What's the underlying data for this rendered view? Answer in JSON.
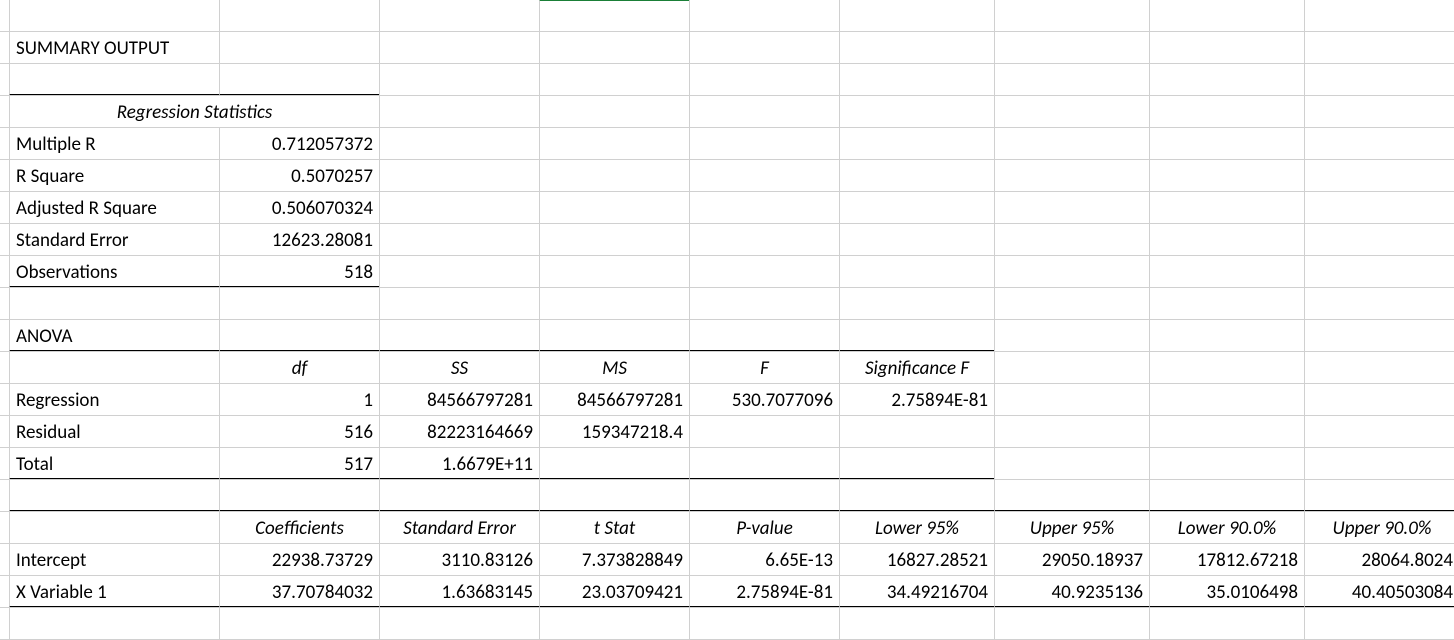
{
  "title": "SUMMARY OUTPUT",
  "regstats": {
    "header": "Regression Statistics",
    "rows": [
      {
        "label": "Multiple R",
        "value": "0.712057372"
      },
      {
        "label": "R Square",
        "value": "0.5070257"
      },
      {
        "label": "Adjusted R Square",
        "value": "0.506070324"
      },
      {
        "label": "Standard Error",
        "value": "12623.28081"
      },
      {
        "label": "Observations",
        "value": "518"
      }
    ]
  },
  "anova": {
    "title": "ANOVA",
    "headers": [
      "df",
      "SS",
      "MS",
      "F",
      "Significance F"
    ],
    "rows": [
      {
        "label": "Regression",
        "df": "1",
        "ss": "84566797281",
        "ms": "84566797281",
        "f": "530.7077096",
        "sigf": "2.75894E-81"
      },
      {
        "label": "Residual",
        "df": "516",
        "ss": "82223164669",
        "ms": "159347218.4",
        "f": "",
        "sigf": ""
      },
      {
        "label": "Total",
        "df": "517",
        "ss": "1.6679E+11",
        "ms": "",
        "f": "",
        "sigf": ""
      }
    ]
  },
  "coef": {
    "headers": [
      "Coefficients",
      "Standard Error",
      "t Stat",
      "P-value",
      "Lower 95%",
      "Upper 95%",
      "Lower 90.0%",
      "Upper 90.0%"
    ],
    "rows": [
      {
        "label": "Intercept",
        "c": "22938.73729",
        "se": "3110.83126",
        "t": "7.373828849",
        "p": "6.65E-13",
        "l95": "16827.28521",
        "u95": "29050.18937",
        "l90": "17812.67218",
        "u90": "28064.8024"
      },
      {
        "label": "X Variable 1",
        "c": "37.70784032",
        "se": "1.63683145",
        "t": "23.03709421",
        "p": "2.75894E-81",
        "l95": "34.49216704",
        "u95": "40.9235136",
        "l90": "35.0106498",
        "u90": "40.40503084"
      }
    ]
  }
}
